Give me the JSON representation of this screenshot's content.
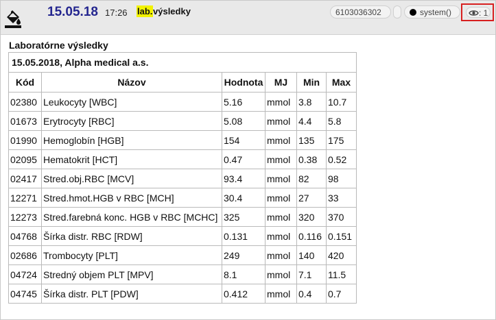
{
  "header": {
    "date": "15.05.18",
    "time": "17:26",
    "type_tag": "lab.",
    "type_title": "výsledky",
    "record_id": "6103036302",
    "user": "system()",
    "views": ": 1",
    "icon": "fill-bucket-icon"
  },
  "section": {
    "title": "Laboratórne výsledky",
    "provider_line": "15.05.2018, Alpha medical a.s."
  },
  "table": {
    "headers": [
      "Kód",
      "Názov",
      "Hodnota",
      "MJ",
      "Min",
      "Max"
    ],
    "rows": [
      [
        "02380",
        "Leukocyty [WBC]",
        "5.16",
        "mmol",
        "3.8",
        "10.7"
      ],
      [
        "01673",
        "Erytrocyty [RBC]",
        "5.08",
        "mmol",
        "4.4",
        "5.8"
      ],
      [
        "01990",
        "Hemoglobín [HGB]",
        "154",
        "mmol",
        "135",
        "175"
      ],
      [
        "02095",
        "Hematokrit [HCT]",
        "0.47",
        "mmol",
        "0.38",
        "0.52"
      ],
      [
        "02417",
        "Stred.obj.RBC [MCV]",
        "93.4",
        "mmol",
        "82",
        "98"
      ],
      [
        "12271",
        "Stred.hmot.HGB v RBC [MCH]",
        "30.4",
        "mmol",
        "27",
        "33"
      ],
      [
        "12273",
        "Stred.farebná konc. HGB v RBC [MCHC]",
        "325",
        "mmol",
        "320",
        "370"
      ],
      [
        "04768",
        "Šírka distr. RBC [RDW]",
        "0.131",
        "mmol",
        "0.116",
        "0.151"
      ],
      [
        "02686",
        "Trombocyty [PLT]",
        "249",
        "mmol",
        "140",
        "420"
      ],
      [
        "04724",
        "Stredný objem PLT [MPV]",
        "8.1",
        "mmol",
        "7.1",
        "11.5"
      ],
      [
        "04745",
        "Šírka distr. PLT [PDW]",
        "0.412",
        "mmol",
        "0.4",
        "0.7"
      ]
    ]
  }
}
